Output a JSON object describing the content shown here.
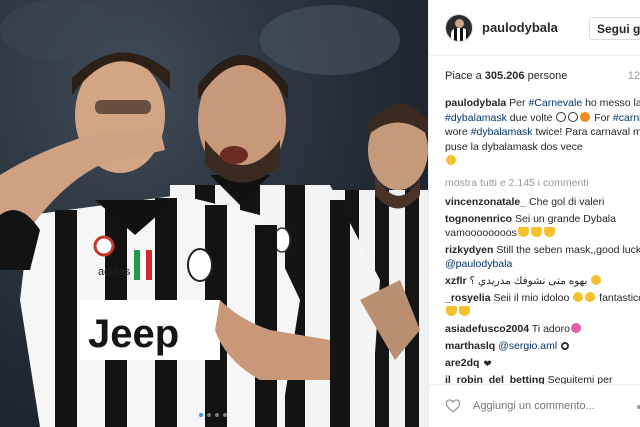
{
  "photo": {
    "jersey_text": "Jeep",
    "kit_brand": "adidas",
    "carousel_dots": 4
  },
  "post": {
    "username": "paulodybala",
    "follow_label": "Segui già",
    "likes_prefix": "Piace a ",
    "likes_count": "305.206",
    "likes_suffix": " persone",
    "timestamp": "12",
    "caption": {
      "username": "paulodybala",
      "t1": " Per ",
      "tag1": "#Carnevale",
      "t2": " ho messo la ",
      "tag2": "#dybalamask",
      "t3": " due volte ",
      "t4": " For ",
      "tag3": "#carnival",
      "t5": " I wore ",
      "tag4": "#dybalamask",
      "t6": " twice! Para carnaval me puse la dybalamask dos vece"
    },
    "view_all_comments": "mostra tutti e 2.145 i commenti",
    "comments": [
      {
        "user": "vincenzonatale_",
        "text": " Che gol di valeri"
      },
      {
        "user": "tognonenrico",
        "text": " Sei un grande Dybala vamoooooooos"
      },
      {
        "user": "rizkydyen",
        "text": " Still the seben mask,,good luck ",
        "mention": "@paulodybala"
      },
      {
        "user": "xzflr",
        "text": " بهوه متى نشوفك مدريدي ؟"
      },
      {
        "user": "_rosyelia",
        "text": " Seii il mio idoloo ",
        "text2": " fantastico"
      },
      {
        "user": "asiadefusco2004",
        "text": " Ti adoro"
      },
      {
        "user": "marthaslq",
        "text": " ",
        "mention": "@sergio.aml"
      },
      {
        "user": "are2dq",
        "text": " "
      },
      {
        "user": "il_robin_del_betting",
        "text": " Seguitemi per"
      }
    ],
    "add_comment_placeholder": "Aggiungi un commento..."
  },
  "colors": {
    "hashtag": "#003569",
    "username": "#262626",
    "muted": "#999999",
    "border": "#efefef",
    "carousel_active": "#3897f0"
  },
  "icons": [
    "heart-icon",
    "more-icon"
  ]
}
